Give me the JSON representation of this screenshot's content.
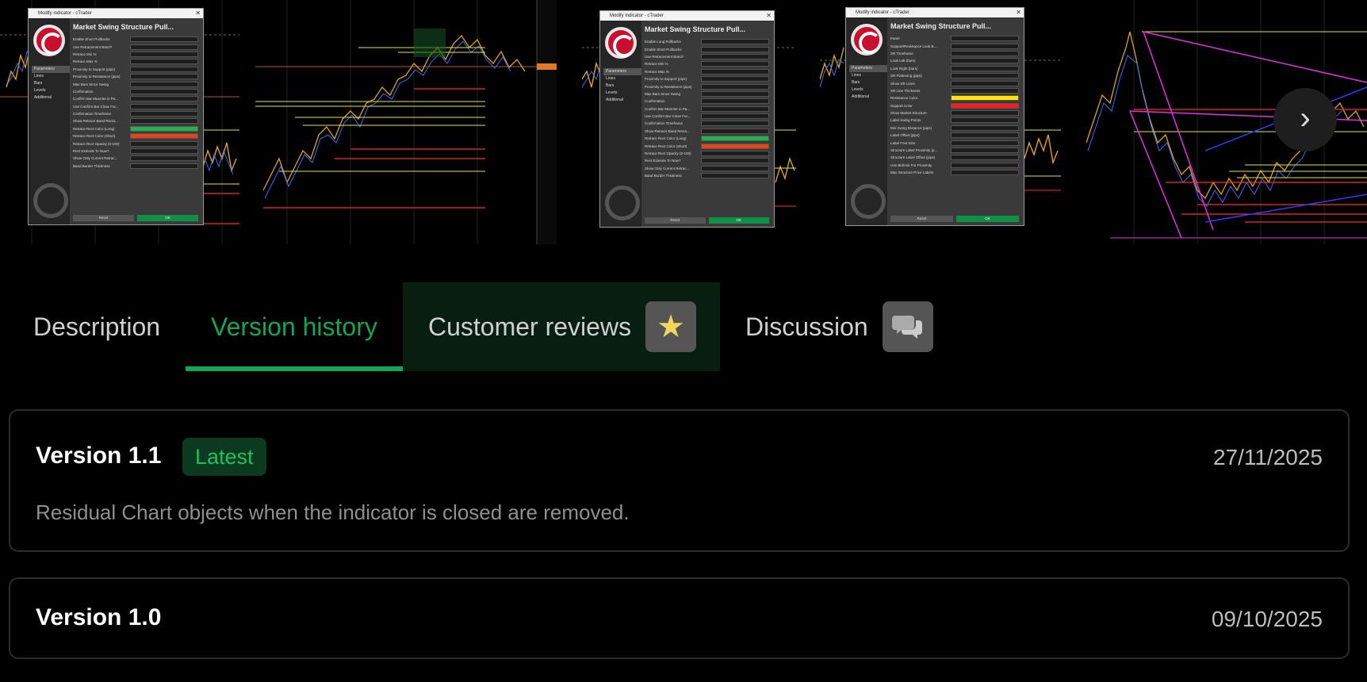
{
  "gallery": {
    "next_icon": "chevron-right-icon",
    "next_glyph": "›",
    "shot1": {
      "window_title": "Modify indicator - cTrader",
      "dialog_title": "Market Swing Structure Pull...",
      "nav": [
        "Parameters",
        "Lines",
        "Bars",
        "Levels",
        "Additional"
      ],
      "rows": [
        "Enable Short Pullbacks",
        "Use Retracement Band?",
        "Retrace Min %",
        "Retrace Max %",
        "Proximity to Support (pips)",
        "Proximity to Resistance (pips)",
        "Max Bars Since Swing",
        "Confirmation",
        "Confirm Bar Must Be in Pa...",
        "Use Confirm Bar Close For...",
        "Confirmation Timeframe",
        "Show Retrace Band Recta...",
        "Retrace Rect Color (Long)",
        "Retrace Rect Color (Short)",
        "Retrace Rect Opacity (0-100)",
        "Rect Extends To Now?",
        "Show Only Current Retrac...",
        "Band Border Thickness"
      ],
      "reset": "Reset",
      "ok": "OK"
    },
    "shot3": {
      "window_title": "Modify indicator - cTrader",
      "dialog_title": "Market Swing Structure Pull...",
      "nav": [
        "Parameters",
        "Lines",
        "Bars",
        "Levels",
        "Additional"
      ],
      "rows": [
        "Enable Long Pullbacks",
        "Enable Short Pullbacks",
        "Use Retracement Band?",
        "Retrace Min %",
        "Retrace Max %",
        "Proximity to Support (pips)",
        "Proximity to Resistance (pips)",
        "Max Bars Since Swing",
        "Confirmation",
        "Confirm Bar Must Be in Pa...",
        "Use Confirm Bar Close For...",
        "Confirmation Timeframe",
        "Show Retrace Band Recta...",
        "Retrace Rect Color (Long)",
        "Retrace Rect Color (Short)",
        "Retrace Rect Opacity (0-100)",
        "Rect Extends To Now?",
        "Show Only Current Retrac...",
        "Band Border Thickness"
      ],
      "reset": "Reset",
      "ok": "OK"
    },
    "shot4": {
      "window_title": "Modify indicator - cTrader",
      "dialog_title": "Market Swing Structure Pull...",
      "nav": [
        "Parameters",
        "Lines",
        "Bars",
        "Levels",
        "Additional"
      ],
      "rows": [
        "Panel",
        "Support/Resistance Look B...",
        "SR Timeframe",
        "Look Left (bars)",
        "Look Right (bars)",
        "SR Flattening (pips)",
        "Show SR Lines",
        "SR Line Thickness",
        "Resistance Color",
        "Support Color",
        "Show Market Structure",
        "Label Swing Points",
        "Min Swing Distance (pips)",
        "Label Offset (pips)",
        "Label Font Size",
        "Structure Label Proximity (p...",
        "Structure Label Offset (pips)",
        "Use Bid/Ask For Proximity",
        "Max Structure Price Labels"
      ],
      "reset": "Reset",
      "ok": "OK"
    }
  },
  "tabs": [
    {
      "label": "Description"
    },
    {
      "label": "Version history"
    },
    {
      "label": "Customer reviews",
      "icon": "star-icon",
      "glyph": "★"
    },
    {
      "label": "Discussion",
      "icon": "chat-bubbles-icon"
    }
  ],
  "versions": [
    {
      "title": "Version 1.1",
      "badge": "Latest",
      "date": "27/11/2025",
      "note": "Residual Chart objects when the indicator is closed are removed."
    },
    {
      "title": "Version 1.0",
      "date": "09/10/2025"
    }
  ],
  "colors": {
    "accent": "#13a656",
    "badge_bg": "#0b3a1f",
    "active_tab_bg": "#071e10"
  }
}
